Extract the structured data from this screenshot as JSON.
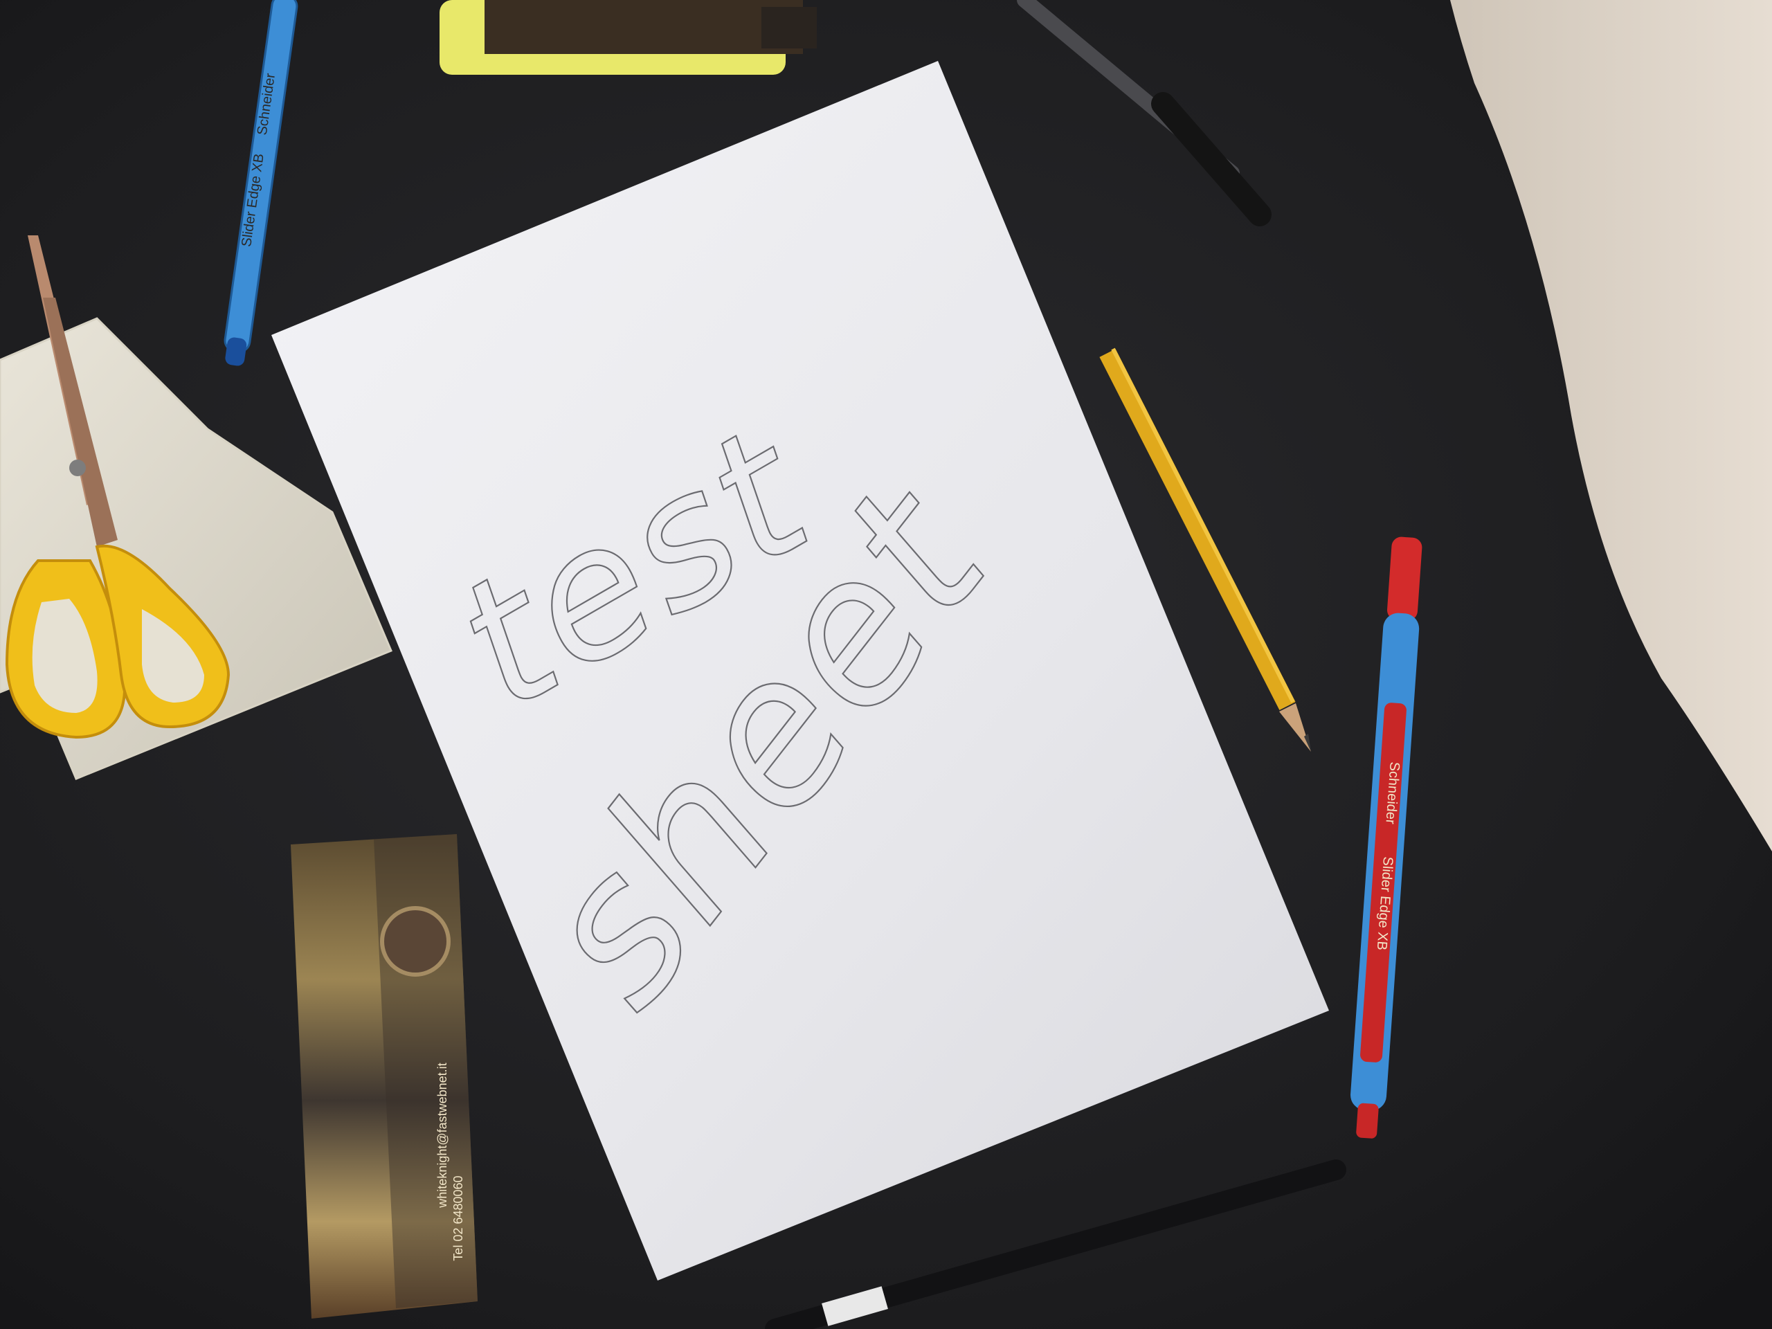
{
  "scene": {
    "description_free": true,
    "colors": {
      "felt": "#1c1c1e",
      "paper": "#ececf0",
      "wood": "#d8cfc3",
      "pencil_yellow": "#e0a91c",
      "scissor_handle": "#f0bf1a",
      "pen_blue": "#3d8ed6",
      "pen_red": "#d32b2b",
      "highlighter": "#e8e86a"
    }
  },
  "sheet": {
    "line1": "test",
    "line2": "sheet"
  },
  "blue_pen": {
    "brand": "Schneider",
    "model": "Slider Edge XB"
  },
  "red_pen": {
    "brand": "Schneider",
    "model": "Slider Edge XB"
  },
  "box": {
    "email": "whiteknight@fastwebnet.it",
    "phone": "Tel 02 6480060"
  }
}
